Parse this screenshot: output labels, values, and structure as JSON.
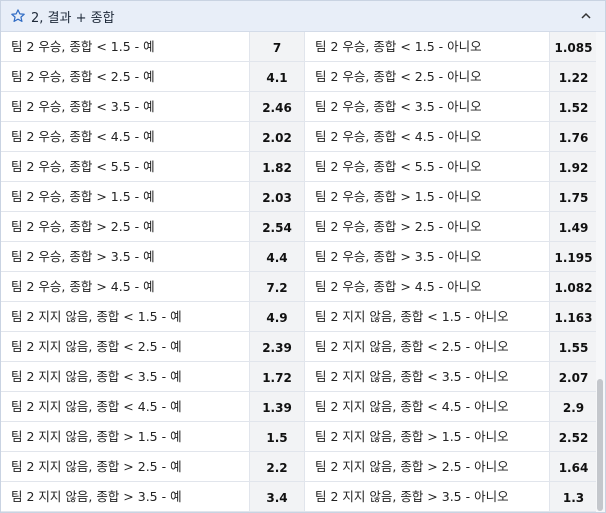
{
  "market": {
    "title": "2, 결과 + 종합",
    "favorite_icon": "star-outline-icon",
    "collapse_icon": "chevron-up-icon"
  },
  "rows": [
    {
      "left_label": "팀 2 우승, 종합 < 1.5 - 예",
      "left_odds": "7",
      "right_label": "팀 2 우승, 종합 < 1.5 - 아니오",
      "right_odds": "1.085"
    },
    {
      "left_label": "팀 2 우승, 종합 < 2.5 - 예",
      "left_odds": "4.1",
      "right_label": "팀 2 우승, 종합 < 2.5 - 아니오",
      "right_odds": "1.22"
    },
    {
      "left_label": "팀 2 우승, 종합 < 3.5 - 예",
      "left_odds": "2.46",
      "right_label": "팀 2 우승, 종합 < 3.5 - 아니오",
      "right_odds": "1.52"
    },
    {
      "left_label": "팀 2 우승, 종합 < 4.5 - 예",
      "left_odds": "2.02",
      "right_label": "팀 2 우승, 종합 < 4.5 - 아니오",
      "right_odds": "1.76"
    },
    {
      "left_label": "팀 2 우승, 종합 < 5.5 - 예",
      "left_odds": "1.82",
      "right_label": "팀 2 우승, 종합 < 5.5 - 아니오",
      "right_odds": "1.92"
    },
    {
      "left_label": "팀 2 우승, 종합 > 1.5 - 예",
      "left_odds": "2.03",
      "right_label": "팀 2 우승, 종합 > 1.5 - 아니오",
      "right_odds": "1.75"
    },
    {
      "left_label": "팀 2 우승, 종합 > 2.5 - 예",
      "left_odds": "2.54",
      "right_label": "팀 2 우승, 종합 > 2.5 - 아니오",
      "right_odds": "1.49"
    },
    {
      "left_label": "팀 2 우승, 종합 > 3.5 - 예",
      "left_odds": "4.4",
      "right_label": "팀 2 우승, 종합 > 3.5 - 아니오",
      "right_odds": "1.195"
    },
    {
      "left_label": "팀 2 우승, 종합 > 4.5 - 예",
      "left_odds": "7.2",
      "right_label": "팀 2 우승, 종합 > 4.5 - 아니오",
      "right_odds": "1.082"
    },
    {
      "left_label": "팀 2 지지 않음, 종합 < 1.5 - 예",
      "left_odds": "4.9",
      "right_label": "팀 2 지지 않음, 종합 < 1.5 - 아니오",
      "right_odds": "1.163"
    },
    {
      "left_label": "팀 2 지지 않음, 종합 < 2.5 - 예",
      "left_odds": "2.39",
      "right_label": "팀 2 지지 않음, 종합 < 2.5 - 아니오",
      "right_odds": "1.55"
    },
    {
      "left_label": "팀 2 지지 않음, 종합 < 3.5 - 예",
      "left_odds": "1.72",
      "right_label": "팀 2 지지 않음, 종합 < 3.5 - 아니오",
      "right_odds": "2.07"
    },
    {
      "left_label": "팀 2 지지 않음, 종합 < 4.5 - 예",
      "left_odds": "1.39",
      "right_label": "팀 2 지지 않음, 종합 < 4.5 - 아니오",
      "right_odds": "2.9"
    },
    {
      "left_label": "팀 2 지지 않음, 종합 > 1.5 - 예",
      "left_odds": "1.5",
      "right_label": "팀 2 지지 않음, 종합 > 1.5 - 아니오",
      "right_odds": "2.52"
    },
    {
      "left_label": "팀 2 지지 않음, 종합 > 2.5 - 예",
      "left_odds": "2.2",
      "right_label": "팀 2 지지 않음, 종합 > 2.5 - 아니오",
      "right_odds": "1.64"
    },
    {
      "left_label": "팀 2 지지 않음, 종합 > 3.5 - 예",
      "left_odds": "3.4",
      "right_label": "팀 2 지지 않음, 종합 > 3.5 - 아니오",
      "right_odds": "1.3"
    }
  ]
}
